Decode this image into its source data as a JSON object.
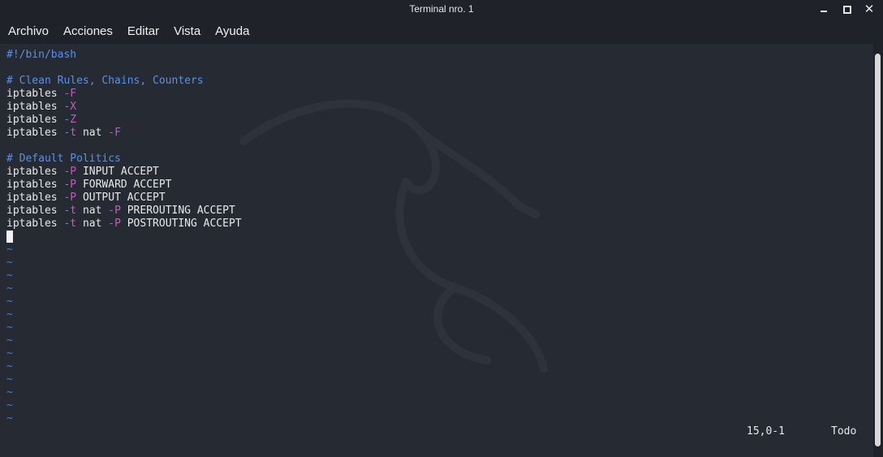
{
  "window": {
    "title": "Terminal nro. 1"
  },
  "menu": {
    "items": [
      "Archivo",
      "Acciones",
      "Editar",
      "Vista",
      "Ayuda"
    ]
  },
  "editor": {
    "shebang": "#!/bin/bash",
    "comment1": "# Clean Rules, Chains, Counters",
    "comment2": "# Default Politics",
    "cmd": "iptables",
    "flag_F": "-F",
    "flag_X": "-X",
    "flag_Z": "-Z",
    "flag_t": "-t",
    "flag_P": "-P",
    "nat": "nat",
    "input_accept": "INPUT ACCEPT",
    "forward_accept": "FORWARD ACCEPT",
    "output_accept": "OUTPUT ACCEPT",
    "prerouting_accept": "PREROUTING ACCEPT",
    "postrouting_accept": "POSTROUTING ACCEPT",
    "tilde": "~"
  },
  "status": {
    "position": "15,0-1",
    "scroll": "Todo"
  },
  "colors": {
    "comment": "#5f8fe0",
    "flag": "#c05bc0",
    "tilde": "#3e7fd8",
    "background": "#262b33"
  }
}
